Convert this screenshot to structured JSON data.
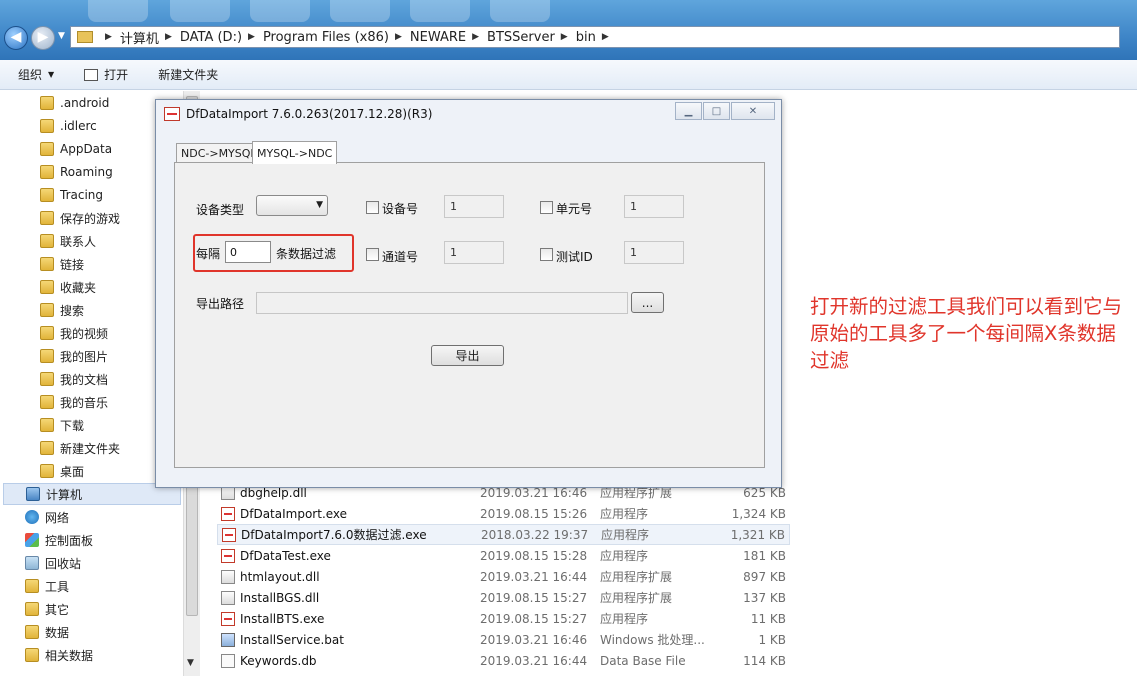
{
  "address": {
    "crumbs": [
      "计算机",
      "DATA (D:)",
      "Program Files (x86)",
      "NEWARE",
      "BTSServer",
      "bin"
    ]
  },
  "toolbar": {
    "organize": "组织",
    "open": "打开",
    "new_folder": "新建文件夹"
  },
  "sidebar": {
    "items": [
      {
        "label": ".android",
        "icon": "folder-icon"
      },
      {
        "label": ".idlerc",
        "icon": "folder-icon"
      },
      {
        "label": "AppData",
        "icon": "folder-icon"
      },
      {
        "label": "Roaming",
        "icon": "folder-icon"
      },
      {
        "label": "Tracing",
        "icon": "folder-icon"
      },
      {
        "label": "保存的游戏",
        "icon": "saved-games-icon"
      },
      {
        "label": "联系人",
        "icon": "contacts-icon"
      },
      {
        "label": "链接",
        "icon": "links-icon"
      },
      {
        "label": "收藏夹",
        "icon": "favorites-icon"
      },
      {
        "label": "搜索",
        "icon": "searches-icon"
      },
      {
        "label": "我的视频",
        "icon": "videos-icon"
      },
      {
        "label": "我的图片",
        "icon": "pictures-icon"
      },
      {
        "label": "我的文档",
        "icon": "documents-icon"
      },
      {
        "label": "我的音乐",
        "icon": "music-icon"
      },
      {
        "label": "下载",
        "icon": "downloads-icon"
      },
      {
        "label": "新建文件夹",
        "icon": "folder-icon"
      },
      {
        "label": "桌面",
        "icon": "desktop-icon"
      },
      {
        "label": "计算机",
        "icon": "computer-icon"
      },
      {
        "label": "网络",
        "icon": "network-icon"
      },
      {
        "label": "控制面板",
        "icon": "control-panel-icon"
      },
      {
        "label": "回收站",
        "icon": "recycle-bin-icon"
      },
      {
        "label": "工具",
        "icon": "folder-icon"
      },
      {
        "label": "其它",
        "icon": "folder-icon"
      },
      {
        "label": "数据",
        "icon": "folder-icon"
      },
      {
        "label": "相关数据",
        "icon": "folder-icon"
      }
    ]
  },
  "files": [
    {
      "name": "dbghelp.dll",
      "date": "2019.03.21 16:46",
      "type": "应用程序扩展",
      "size": "625 KB",
      "icon": "dll-file-icon"
    },
    {
      "name": "DfDataImport.exe",
      "date": "2019.08.15 15:26",
      "type": "应用程序",
      "size": "1,324 KB",
      "icon": "exe-file-icon"
    },
    {
      "name": "DfDataImport7.6.0数据过滤.exe",
      "date": "2018.03.22 19:37",
      "type": "应用程序",
      "size": "1,321 KB",
      "icon": "exe-file-icon"
    },
    {
      "name": "DfDataTest.exe",
      "date": "2019.08.15 15:28",
      "type": "应用程序",
      "size": "181 KB",
      "icon": "exe-file-icon"
    },
    {
      "name": "htmlayout.dll",
      "date": "2019.03.21 16:44",
      "type": "应用程序扩展",
      "size": "897 KB",
      "icon": "dll-file-icon"
    },
    {
      "name": "InstallBGS.dll",
      "date": "2019.08.15 15:27",
      "type": "应用程序扩展",
      "size": "137 KB",
      "icon": "dll-file-icon"
    },
    {
      "name": "InstallBTS.exe",
      "date": "2019.08.15 15:27",
      "type": "应用程序",
      "size": "11 KB",
      "icon": "exe-file-icon"
    },
    {
      "name": "InstallService.bat",
      "date": "2019.03.21 16:46",
      "type": "Windows 批处理...",
      "size": "1 KB",
      "icon": "bat-file-icon"
    },
    {
      "name": "Keywords.db",
      "date": "2019.03.21 16:44",
      "type": "Data Base File",
      "size": "114 KB",
      "icon": "db-file-icon"
    }
  ],
  "dialog": {
    "title": "DfDataImport 7.6.0.263(2017.12.28)(R3)",
    "tabs": [
      "NDC->MYSQL",
      "MYSQL->NDC"
    ],
    "device_type_label": "设备类型",
    "device_no_label": "设备号",
    "device_no_value": "1",
    "unit_no_label": "单元号",
    "unit_no_value": "1",
    "every_label": "每隔",
    "every_value": "0",
    "every_suffix": "条数据过滤",
    "channel_label": "通道号",
    "channel_value": "1",
    "test_id_label": "测试ID",
    "test_id_value": "1",
    "export_path_label": "导出路径",
    "browse_label": "...",
    "export_button": "导出"
  },
  "annotation": {
    "text": "打开新的过滤工具我们可以看到它与原始的工具多了一个每间隔X条数据过滤",
    "color": "#e0352b"
  }
}
